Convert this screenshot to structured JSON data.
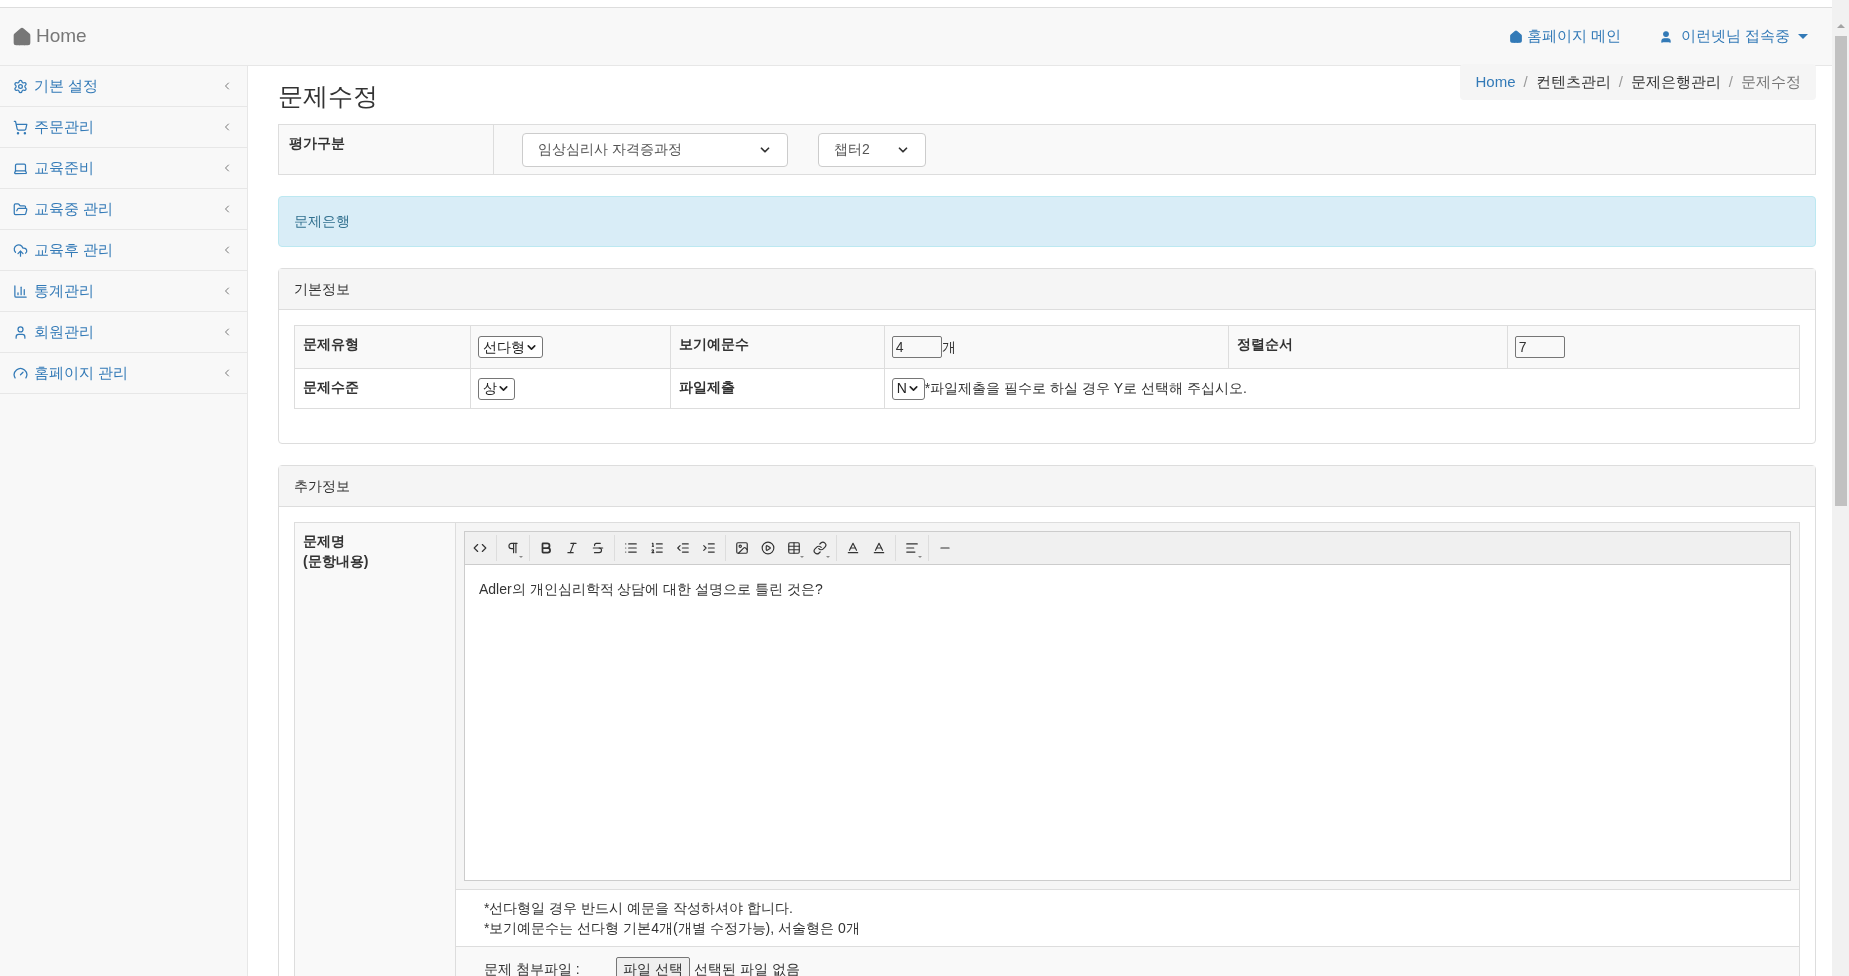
{
  "navbar": {
    "brand": "Home",
    "links": [
      {
        "label": "홈페이지 메인",
        "kind": "home"
      },
      {
        "label": "이런넷님 접속중",
        "kind": "user"
      }
    ]
  },
  "sidebar": {
    "items": [
      {
        "label": "기본 설정",
        "kind": "settings"
      },
      {
        "label": "주문관리",
        "kind": "cart"
      },
      {
        "label": "교육준비",
        "kind": "laptop"
      },
      {
        "label": "교육중 관리",
        "kind": "folder"
      },
      {
        "label": "교육후 관리",
        "kind": "cloud"
      },
      {
        "label": "통계관리",
        "kind": "chart"
      },
      {
        "label": "회원관리",
        "kind": "user"
      },
      {
        "label": "홈페이지 관리",
        "kind": "gauge"
      }
    ]
  },
  "page_title": "문제수정",
  "breadcrumb_separator": "/",
  "breadcrumb": [
    {
      "label": "Home",
      "kind": "link"
    },
    {
      "label": "컨텐츠관리",
      "kind": "text"
    },
    {
      "label": "문제은행관리",
      "kind": "text"
    },
    {
      "label": "문제수정",
      "kind": "active"
    }
  ],
  "evaluation": {
    "label": "평가구분",
    "course": "임상심리사 자격증과정",
    "chapter": "챕터2"
  },
  "alert": "문제은행",
  "basic_info": {
    "title": "기본정보",
    "rows": [
      [
        {
          "label": "문제유형",
          "kind": "select",
          "value": "선다형"
        },
        {
          "label": "보기예문수",
          "kind": "input",
          "value": "4",
          "suffix": "개"
        },
        {
          "label": "정렬순서",
          "kind": "input",
          "value": "7"
        }
      ],
      [
        {
          "label": "문제수준",
          "kind": "select",
          "value": "상"
        },
        {
          "label": "파일제출",
          "kind": "select",
          "value": "N",
          "suffix": "*파일제출을 필수로 하실 경우 Y로 선택해 주십시오."
        }
      ]
    ]
  },
  "extra_info": {
    "title": "추가정보",
    "question_label": [
      "문제명",
      "(문항내용)"
    ],
    "editor_text": "Adler의 개인심리학적 상담에 대한 설명으로 틀린 것은?",
    "notes": [
      "*선다형일 경우 반드시 예문을 작성하셔야 합니다.",
      "*보기예문수는 선다형 기본4개(개별 수정가능), 서술형은 0개"
    ],
    "attachment": {
      "label": "문제 첨부파일 :",
      "button": "파일 선택",
      "status": "선택된 파일 없음"
    }
  }
}
